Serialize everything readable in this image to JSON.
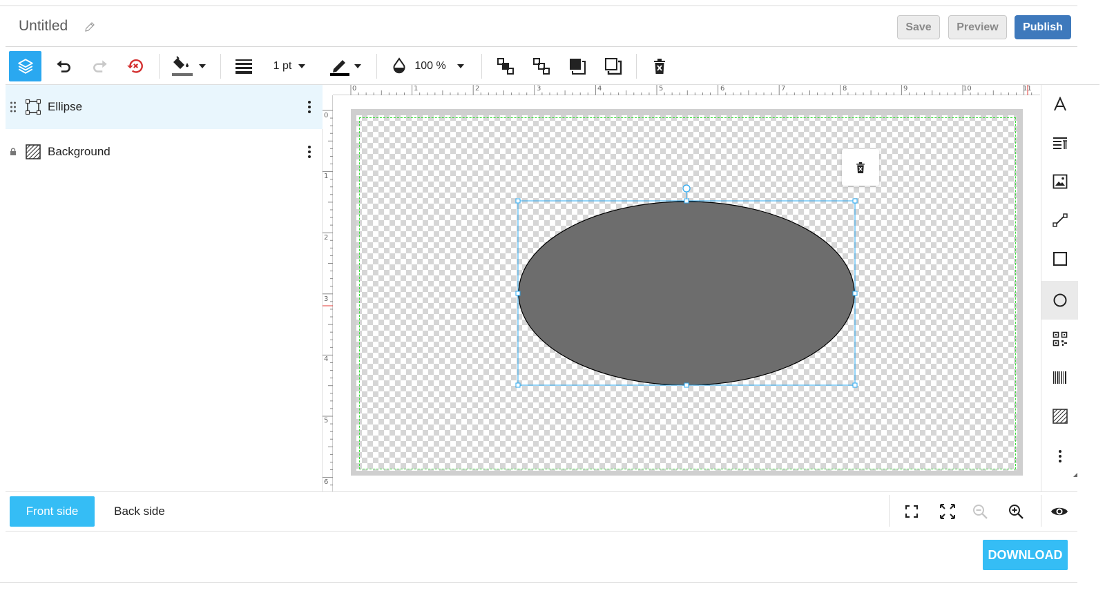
{
  "document": {
    "title": "Untitled"
  },
  "header": {
    "save_label": "Save",
    "preview_label": "Preview",
    "publish_label": "Publish"
  },
  "toolbar": {
    "stroke_width": "1 pt",
    "opacity": "100 %",
    "fill_color": "#6d6d6d",
    "stroke_color": "#000000"
  },
  "layers": [
    {
      "label": "Ellipse",
      "icon": "shape-icon",
      "selected": true
    },
    {
      "label": "Background",
      "icon": "background-icon",
      "locked": true
    }
  ],
  "ruler": {
    "top_labels": [
      "0",
      "1",
      "2",
      "3",
      "4",
      "5",
      "6",
      "7",
      "8",
      "9",
      "10",
      "11"
    ],
    "left_labels": [
      "0",
      "1",
      "2",
      "3",
      "4",
      "5",
      "6"
    ]
  },
  "canvas": {
    "ellipse_fill": "#6d6d6d",
    "ellipse_stroke": "#000000",
    "selection_color": "#2aa8f0",
    "safe_area_color": "#3ddc3d"
  },
  "right_tools": [
    {
      "icon": "text-icon"
    },
    {
      "icon": "text-block-icon"
    },
    {
      "icon": "image-icon"
    },
    {
      "icon": "line-icon"
    },
    {
      "icon": "rectangle-icon"
    },
    {
      "icon": "ellipse-icon",
      "active": true
    },
    {
      "icon": "qr-code-icon"
    },
    {
      "icon": "barcode-icon"
    },
    {
      "icon": "background-icon"
    },
    {
      "icon": "more-icon"
    }
  ],
  "bottom": {
    "front_label": "Front side",
    "back_label": "Back side"
  },
  "footer": {
    "download_label": "DOWNLOAD"
  },
  "colors": {
    "accent": "#35bdf5",
    "primary": "#3e79bc",
    "undo_reset": "#d32f2f"
  }
}
